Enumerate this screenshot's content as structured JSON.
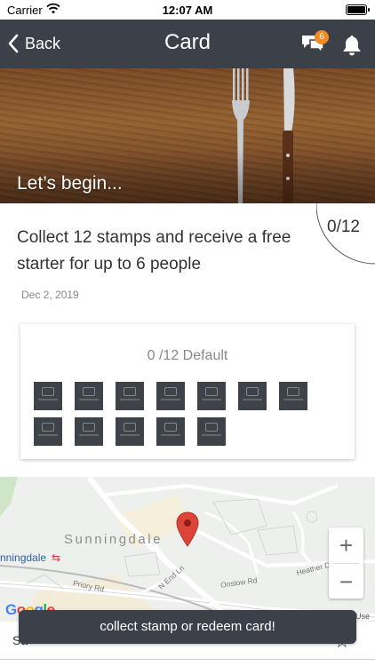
{
  "status_bar": {
    "carrier": "Carrier",
    "time": "12:07 AM"
  },
  "nav": {
    "back_label": "Back",
    "title": "Card",
    "chat_badge": "6"
  },
  "hero": {
    "text": "Let’s begin..."
  },
  "offer": {
    "progress": "0/12",
    "title": "Collect 12 stamps and receive a free starter for up to 6 people",
    "date": "Dec 2, 2019"
  },
  "stamp_card": {
    "label": "0 /12 Default",
    "stamps_total": 12,
    "stamps_collected": 0
  },
  "map": {
    "place": "Sunningdale",
    "station": "nningdale",
    "roads": [
      "Priory Rd",
      "N End Ln",
      "Onslow Rd",
      "Heather Dr"
    ],
    "attribution": "Google",
    "terms": "Use",
    "zoom_in": "+",
    "zoom_out": "−"
  },
  "bottom": {
    "save_label": "Sa",
    "toast": "collect stamp or redeem card!"
  },
  "colors": {
    "nav": "#3c4149",
    "badge": "#f08a24",
    "pin": "#db4437",
    "stamp": "#3e434a"
  }
}
